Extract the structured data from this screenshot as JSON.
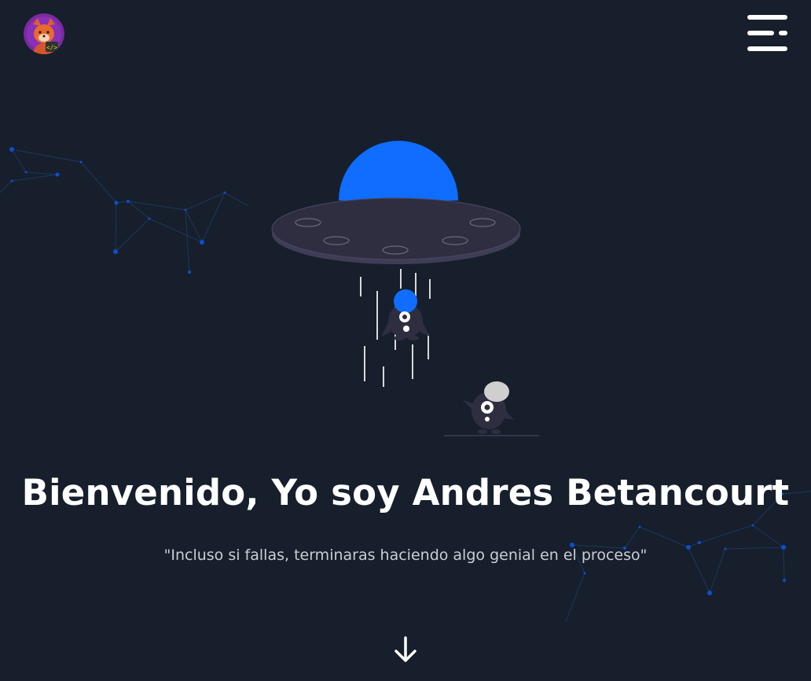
{
  "header": {
    "avatar_icon": "fox-developer-avatar-icon",
    "menu_icon": "hamburger-menu-icon"
  },
  "hero": {
    "illustration": "ufo-abduction-illustration",
    "title": "Bienvenido, Yo soy Andres Betancourt",
    "quote": "\"Incluso si fallas, terminaras haciendo algo genial en el proceso\"",
    "scroll_icon": "arrow-down-icon"
  },
  "colors": {
    "background": "#161f2b",
    "accent": "#0f6dff",
    "text": "#ffffff",
    "muted_text": "#c9ced6",
    "network_line": "#1f3b6e",
    "network_dot": "#0b4fd0"
  }
}
